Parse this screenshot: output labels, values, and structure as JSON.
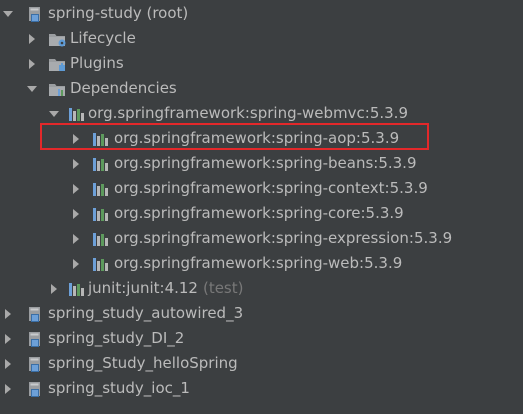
{
  "tree": {
    "root": {
      "label": "spring-study (root)",
      "expanded": true
    },
    "lifecycle": {
      "label": "Lifecycle"
    },
    "plugins": {
      "label": "Plugins"
    },
    "dependencies": {
      "label": "Dependencies",
      "expanded": true
    },
    "webmvc": {
      "label": "org.springframework:spring-webmvc:5.3.9",
      "expanded": true
    },
    "webmvc_children": [
      {
        "label": "org.springframework:spring-aop:5.3.9",
        "highlighted": true
      },
      {
        "label": "org.springframework:spring-beans:5.3.9"
      },
      {
        "label": "org.springframework:spring-context:5.3.9"
      },
      {
        "label": "org.springframework:spring-core:5.3.9"
      },
      {
        "label": "org.springframework:spring-expression:5.3.9"
      },
      {
        "label": "org.springframework:spring-web:5.3.9"
      }
    ],
    "junit": {
      "label": "junit:junit:4.12",
      "scope": "(test)"
    },
    "modules": [
      {
        "label": "spring_study_autowired_3"
      },
      {
        "label": "spring_study_DI_2"
      },
      {
        "label": "spring_Study_helloSpring"
      },
      {
        "label": "spring_study_ioc_1"
      }
    ]
  },
  "colors": {
    "background": "#3c3f41",
    "text": "#bbbbbb",
    "scope_text": "#787878",
    "highlight_border": "#e3282a",
    "icon_blue": "#5e9bd6"
  },
  "icons": {
    "expanded": "triangle-down-icon",
    "collapsed": "triangle-right-icon",
    "module": "maven-module-icon",
    "lifecycle": "lifecycle-folder-icon",
    "plugins": "plugins-folder-icon",
    "dependencies": "dependencies-folder-icon",
    "library": "library-bars-icon"
  }
}
